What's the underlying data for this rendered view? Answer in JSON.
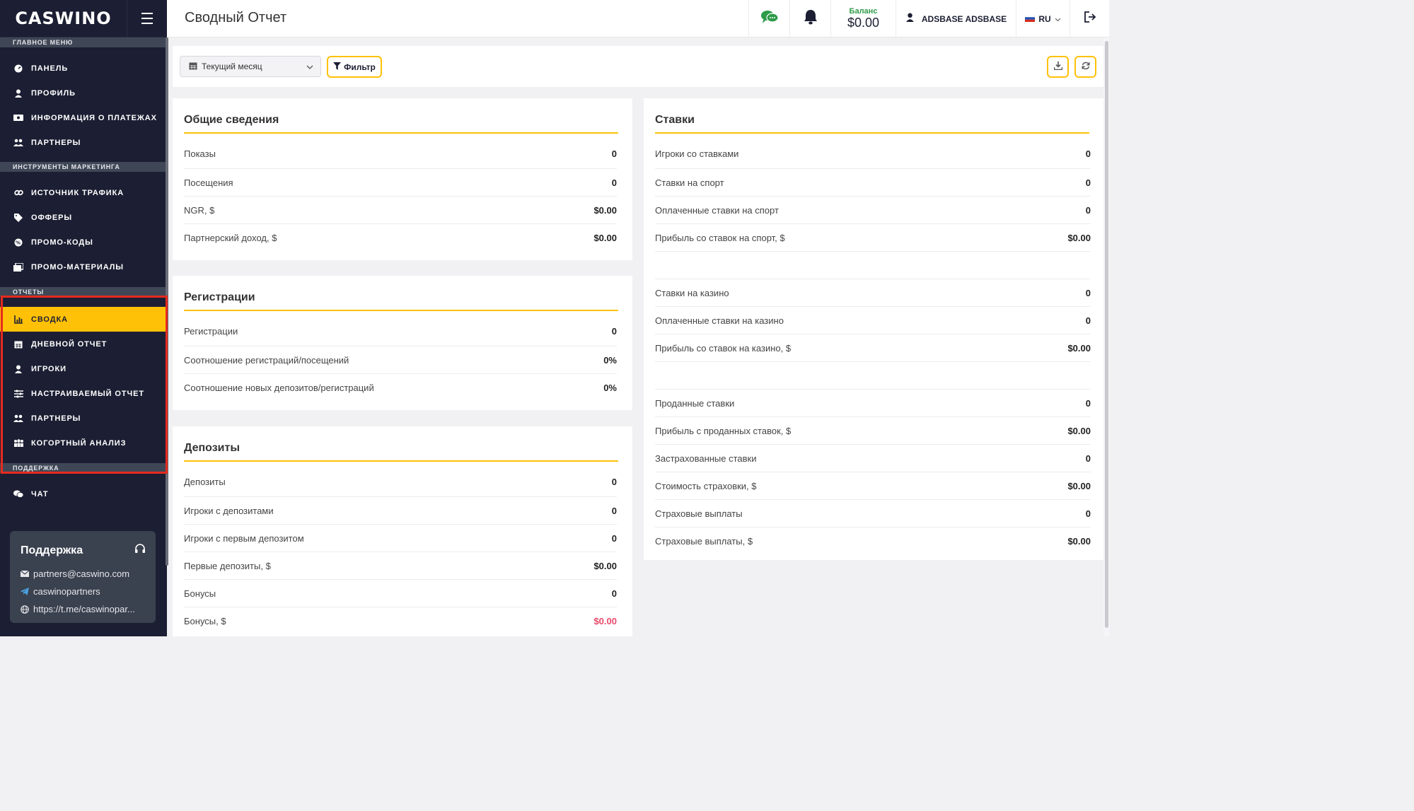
{
  "brand": {
    "logo_text": "CASWINO"
  },
  "header": {
    "title": "Сводный Отчет",
    "balance_label": "Баланс",
    "balance_value": "$0.00",
    "user_name": "ADSBASE ADSBASE",
    "language": "RU"
  },
  "sidebar": {
    "sections": [
      {
        "label": "ГЛАВНОЕ МЕНЮ",
        "items": [
          {
            "label": "ПАНЕЛЬ",
            "icon": "dashboard-icon"
          },
          {
            "label": "ПРОФИЛЬ",
            "icon": "user-icon"
          },
          {
            "label": "ИНФОРМАЦИЯ О ПЛАТЕЖАХ",
            "icon": "money-icon"
          },
          {
            "label": "ПАРТНЕРЫ",
            "icon": "users-icon"
          }
        ]
      },
      {
        "label": "ИНСТРУМЕНТЫ МАРКЕТИНГА",
        "items": [
          {
            "label": "ИСТОЧНИК ТРАФИКА",
            "icon": "link-icon"
          },
          {
            "label": "ОФФЕРЫ",
            "icon": "tags-icon"
          },
          {
            "label": "ПРОМО-КОДЫ",
            "icon": "badge-icon"
          },
          {
            "label": "ПРОМО-МАТЕРИАЛЫ",
            "icon": "images-icon"
          }
        ]
      },
      {
        "label": "ОТЧЕТЫ",
        "items": [
          {
            "label": "СВОДКА",
            "icon": "chart-icon",
            "active": true
          },
          {
            "label": "ДНЕВНОЙ ОТЧЕТ",
            "icon": "calendar-icon"
          },
          {
            "label": "ИГРОКИ",
            "icon": "user-icon"
          },
          {
            "label": "НАСТРАИВАЕМЫЙ ОТЧЕТ",
            "icon": "sliders-icon"
          },
          {
            "label": "ПАРТНЕРЫ",
            "icon": "users-icon"
          },
          {
            "label": "КОГОРТНЫЙ АНАЛИЗ",
            "icon": "group-icon"
          }
        ]
      },
      {
        "label": "ПОДДЕРЖКА",
        "items": [
          {
            "label": "ЧАТ",
            "icon": "chat-icon"
          }
        ]
      }
    ],
    "support": {
      "title": "Поддержка",
      "email": "partners@caswino.com",
      "telegram": "caswinopartners",
      "link": "https://t.me/caswinopar..."
    }
  },
  "toolbar": {
    "period": "Текущий месяц",
    "filter_label": "Фильтр"
  },
  "cards": {
    "general": {
      "title": "Общие сведения",
      "rows": [
        {
          "label": "Показы",
          "value": "0"
        },
        {
          "label": "Посещения",
          "value": "0"
        },
        {
          "label": "NGR, $",
          "value": "$0.00"
        },
        {
          "label": "Партнерский доход, $",
          "value": "$0.00"
        }
      ]
    },
    "registrations": {
      "title": "Регистрации",
      "rows": [
        {
          "label": "Регистрации",
          "value": "0"
        },
        {
          "label": "Соотношение регистраций/посещений",
          "value": "0%"
        },
        {
          "label": "Соотношение новых депозитов/регистраций",
          "value": "0%"
        }
      ]
    },
    "deposits": {
      "title": "Депозиты",
      "rows": [
        {
          "label": "Депозиты",
          "value": "0"
        },
        {
          "label": "Игроки с депозитами",
          "value": "0"
        },
        {
          "label": "Игроки с первым депозитом",
          "value": "0"
        },
        {
          "label": "Первые депозиты, $",
          "value": "$0.00"
        },
        {
          "label": "Бонусы",
          "value": "0"
        },
        {
          "label": "Бонусы, $",
          "value": "$0.00",
          "negative": true
        }
      ]
    },
    "bets": {
      "title": "Ставки",
      "rows": [
        {
          "label": "Игроки со ставками",
          "value": "0"
        },
        {
          "label": "Ставки на спорт",
          "value": "0"
        },
        {
          "label": "Оплаченные ставки на спорт",
          "value": "0"
        },
        {
          "label": "Прибыль со ставок на спорт, $",
          "value": "$0.00"
        },
        {
          "label": "",
          "value": ""
        },
        {
          "label": "Ставки на казино",
          "value": "0"
        },
        {
          "label": "Оплаченные ставки на казино",
          "value": "0"
        },
        {
          "label": "Прибыль со ставок на казино, $",
          "value": "$0.00"
        },
        {
          "label": "",
          "value": ""
        },
        {
          "label": "Проданные ставки",
          "value": "0"
        },
        {
          "label": "Прибыль с проданных ставок, $",
          "value": "$0.00"
        },
        {
          "label": "Застрахованные ставки",
          "value": "0"
        },
        {
          "label": "Стоимость страховки, $",
          "value": "$0.00"
        },
        {
          "label": "Страховые выплаты",
          "value": "0"
        },
        {
          "label": "Страховые выплаты, $",
          "value": "$0.00"
        }
      ]
    }
  },
  "colors": {
    "accent": "#ffc107",
    "sidebar": "#1c1f33",
    "negative": "#e74a6a",
    "balance_label": "#2e9b49"
  }
}
